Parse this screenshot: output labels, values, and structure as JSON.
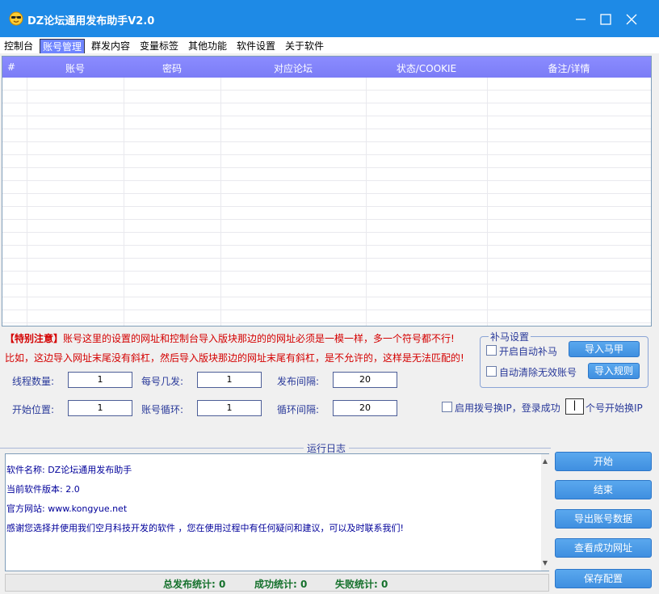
{
  "window": {
    "title": "DZ论坛通用发布助手V2.0"
  },
  "tabs": [
    "控制台",
    "账号管理",
    "群发内容",
    "变量标签",
    "其他功能",
    "软件设置",
    "关于软件"
  ],
  "grid": {
    "columns": [
      "#",
      "账号",
      "密码",
      "对应论坛",
      "状态/COOKIE",
      "备注/详情"
    ],
    "rows": []
  },
  "notices": {
    "line1_prefix": "【特别注意】",
    "line1_rest": "账号这里的设置的网址和控制台导入版块那边的的网址必须是一模一样，多一个符号都不行!",
    "line2": "比如，这边导入网址末尾没有斜杠，然后导入版块那边的网址末尾有斜杠，是不允许的，这样是无法匹配的!"
  },
  "settings": {
    "thread_count_label": "线程数量:",
    "thread_count": "1",
    "per_account_label": "每号几发:",
    "per_account": "1",
    "post_interval_label": "发布间隔:",
    "post_interval": "20",
    "start_position_label": "开始位置:",
    "start_position": "1",
    "account_loop_label": "账号循环:",
    "account_loop": "1",
    "loop_interval_label": "循环间隔:",
    "loop_interval": "20"
  },
  "bumaa": {
    "title": "补马设置",
    "auto_label": "开启自动补马",
    "import_vest_button": "导入马甲",
    "auto_clear_label": "自动清除无效账号",
    "import_rules_button": "导入规则"
  },
  "dial": {
    "label": "启用拨号换IP，登录成功",
    "value": "|",
    "suffix": "个号开始换IP"
  },
  "log": {
    "title": "运行日志",
    "lines": [
      "软件名称: DZ论坛通用发布助手",
      "当前软件版本: 2.0",
      "官方网站: www.kongyue.net",
      "感谢您选择并使用我们空月科技开发的软件 ，您在使用过程中有任何疑问和建议，可以及时联系我们!"
    ]
  },
  "status": {
    "total_label": "总发布统计: 0",
    "success_label": "成功统计: 0",
    "fail_label": "失败统计: 0"
  },
  "actions": [
    "开始",
    "结束",
    "导出账号数据",
    "查看成功网址",
    "保存配置"
  ],
  "colors": {
    "titlebar": "#1e8ae6",
    "grid_header": "#8b8cff",
    "button": "#4a9ae8",
    "notice": "#d40000",
    "status_text": "#15712c"
  }
}
